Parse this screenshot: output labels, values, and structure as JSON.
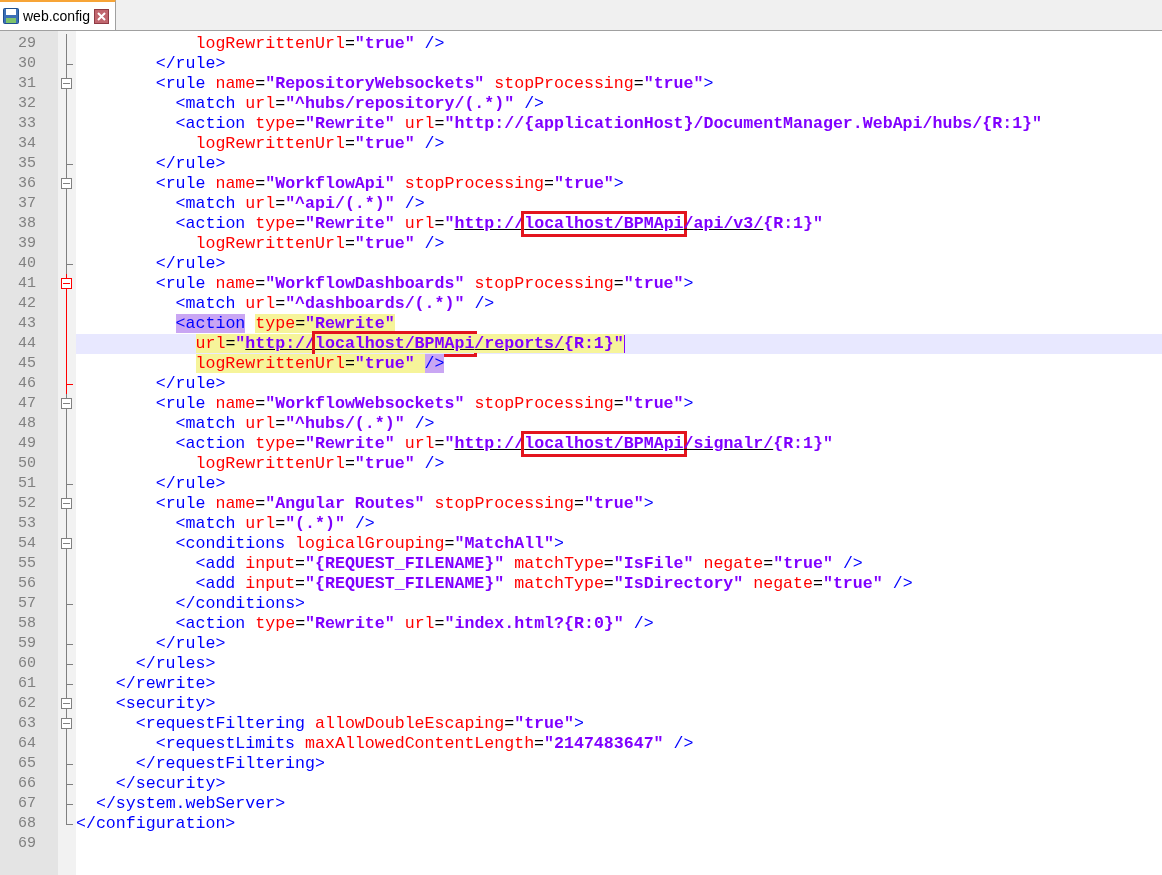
{
  "tabs": [
    {
      "label": "web.config",
      "selected": true
    }
  ],
  "lines": [
    {
      "number": "29",
      "kind": "line",
      "active": false,
      "tokens": [
        {
          "kind": "attr",
          "text": "            logRewrittenUrl"
        },
        {
          "kind": "punct",
          "text": "="
        },
        {
          "kind": "value",
          "text": "\"true\""
        },
        {
          "kind": "tag",
          "text": " />"
        }
      ]
    },
    {
      "number": "30",
      "kind": "tick",
      "active": false,
      "tokens": [
        {
          "kind": "tag",
          "text": "        </rule>"
        }
      ]
    },
    {
      "number": "31",
      "kind": "open",
      "active": false,
      "tokens": [
        {
          "kind": "tag",
          "text": "        <rule"
        },
        {
          "kind": "attr",
          "text": " name"
        },
        {
          "kind": "punct",
          "text": "="
        },
        {
          "kind": "value",
          "text": "\"RepositoryWebsockets\""
        },
        {
          "kind": "attr",
          "text": " stopProcessing"
        },
        {
          "kind": "punct",
          "text": "="
        },
        {
          "kind": "value",
          "text": "\"true\""
        },
        {
          "kind": "tag",
          "text": ">"
        }
      ]
    },
    {
      "number": "32",
      "kind": "line",
      "active": false,
      "tokens": [
        {
          "kind": "tag",
          "text": "          <match"
        },
        {
          "kind": "attr",
          "text": " url"
        },
        {
          "kind": "punct",
          "text": "="
        },
        {
          "kind": "value",
          "text": "\"^hubs/repository/(.*)\""
        },
        {
          "kind": "tag",
          "text": " />"
        }
      ]
    },
    {
      "number": "33",
      "kind": "line",
      "active": false,
      "tokens": [
        {
          "kind": "tag",
          "text": "          <action"
        },
        {
          "kind": "attr",
          "text": " type"
        },
        {
          "kind": "punct",
          "text": "="
        },
        {
          "kind": "value",
          "text": "\"Rewrite\""
        },
        {
          "kind": "attr",
          "text": " url"
        },
        {
          "kind": "punct",
          "text": "="
        },
        {
          "kind": "value",
          "text": "\"http://{applicationHost}/DocumentManager.WebApi/hubs/{R:1}\""
        }
      ]
    },
    {
      "number": "34",
      "kind": "line",
      "active": false,
      "tokens": [
        {
          "kind": "attr",
          "text": "            logRewrittenUrl"
        },
        {
          "kind": "punct",
          "text": "="
        },
        {
          "kind": "value",
          "text": "\"true\""
        },
        {
          "kind": "tag",
          "text": " />"
        }
      ]
    },
    {
      "number": "35",
      "kind": "tick",
      "active": false,
      "tokens": [
        {
          "kind": "tag",
          "text": "        </rule>"
        }
      ]
    },
    {
      "number": "36",
      "kind": "open",
      "active": false,
      "tokens": [
        {
          "kind": "tag",
          "text": "        <rule"
        },
        {
          "kind": "attr",
          "text": " name"
        },
        {
          "kind": "punct",
          "text": "="
        },
        {
          "kind": "value",
          "text": "\"WorkflowApi\""
        },
        {
          "kind": "attr",
          "text": " stopProcessing"
        },
        {
          "kind": "punct",
          "text": "="
        },
        {
          "kind": "value",
          "text": "\"true\""
        },
        {
          "kind": "tag",
          "text": ">"
        }
      ]
    },
    {
      "number": "37",
      "kind": "line",
      "active": false,
      "tokens": [
        {
          "kind": "tag",
          "text": "          <match"
        },
        {
          "kind": "attr",
          "text": " url"
        },
        {
          "kind": "punct",
          "text": "="
        },
        {
          "kind": "value",
          "text": "\"^api/(.*)\""
        },
        {
          "kind": "tag",
          "text": " />"
        }
      ]
    },
    {
      "number": "38",
      "kind": "line",
      "active": false,
      "tokens": [
        {
          "kind": "tag",
          "text": "          <action"
        },
        {
          "kind": "attr",
          "text": " type"
        },
        {
          "kind": "punct",
          "text": "="
        },
        {
          "kind": "value",
          "text": "\"Rewrite\""
        },
        {
          "kind": "attr",
          "text": " url"
        },
        {
          "kind": "punct",
          "text": "="
        },
        {
          "kind": "value",
          "text": "\""
        },
        {
          "kind": "link",
          "text": "http://"
        },
        {
          "kind": "link",
          "text": "localhost/BPMApi",
          "boxed": true
        },
        {
          "kind": "link",
          "text": "/api/v3/"
        },
        {
          "kind": "value",
          "text": "{R:1}\""
        }
      ]
    },
    {
      "number": "39",
      "kind": "line",
      "active": false,
      "tokens": [
        {
          "kind": "attr",
          "text": "            logRewrittenUrl"
        },
        {
          "kind": "punct",
          "text": "="
        },
        {
          "kind": "value",
          "text": "\"true\""
        },
        {
          "kind": "tag",
          "text": " />"
        }
      ]
    },
    {
      "number": "40",
      "kind": "tick",
      "active": false,
      "tokens": [
        {
          "kind": "tag",
          "text": "        </rule>"
        }
      ]
    },
    {
      "number": "41",
      "kind": "open",
      "active": true,
      "tokens": [
        {
          "kind": "tag",
          "text": "        <rule"
        },
        {
          "kind": "attr",
          "text": " name"
        },
        {
          "kind": "punct",
          "text": "="
        },
        {
          "kind": "value",
          "text": "\"WorkflowDashboards\""
        },
        {
          "kind": "attr",
          "text": " stopProcessing"
        },
        {
          "kind": "punct",
          "text": "="
        },
        {
          "kind": "value",
          "text": "\"true\""
        },
        {
          "kind": "tag",
          "text": ">"
        }
      ]
    },
    {
      "number": "42",
      "kind": "line",
      "active": true,
      "tokens": [
        {
          "kind": "tag",
          "text": "          <match"
        },
        {
          "kind": "attr",
          "text": " url"
        },
        {
          "kind": "punct",
          "text": "="
        },
        {
          "kind": "value",
          "text": "\"^dashboards/(.*)\""
        },
        {
          "kind": "tag",
          "text": " />"
        }
      ]
    },
    {
      "number": "43",
      "kind": "line",
      "active": true,
      "tokens": [
        {
          "kind": "tag",
          "text": "          <action",
          "matched": true
        },
        {
          "kind": "attr",
          "text": " type",
          "marked": true
        },
        {
          "kind": "punct",
          "text": "=",
          "marked": true
        },
        {
          "kind": "value",
          "text": "\"Rewrite\"",
          "marked": true
        }
      ]
    },
    {
      "number": "44",
      "kind": "line",
      "active": true,
      "current": true,
      "caret": true,
      "tokens": [
        {
          "kind": "attr",
          "text": "            url",
          "marked": true
        },
        {
          "kind": "punct",
          "text": "=",
          "marked": true
        },
        {
          "kind": "value",
          "text": "\"",
          "marked": true
        },
        {
          "kind": "link",
          "text": "http://",
          "marked": true
        },
        {
          "kind": "link",
          "text": "localhost/BPMApi",
          "marked": true,
          "boxed": true
        },
        {
          "kind": "link",
          "text": "/reports/",
          "marked": true
        },
        {
          "kind": "value",
          "text": "{R:1}\"",
          "marked": true
        }
      ]
    },
    {
      "number": "45",
      "kind": "line",
      "active": true,
      "tokens": [
        {
          "kind": "attr",
          "text": "            logRewrittenUrl",
          "marked": true
        },
        {
          "kind": "punct",
          "text": "=",
          "marked": true
        },
        {
          "kind": "value",
          "text": "\"true\" ",
          "marked": true
        },
        {
          "kind": "tag",
          "text": "/>",
          "matched": true
        }
      ]
    },
    {
      "number": "46",
      "kind": "tick",
      "active": true,
      "tokens": [
        {
          "kind": "tag",
          "text": "        </rule>"
        }
      ]
    },
    {
      "number": "47",
      "kind": "open",
      "active": false,
      "tokens": [
        {
          "kind": "tag",
          "text": "        <rule"
        },
        {
          "kind": "attr",
          "text": " name"
        },
        {
          "kind": "punct",
          "text": "="
        },
        {
          "kind": "value",
          "text": "\"WorkflowWebsockets\""
        },
        {
          "kind": "attr",
          "text": " stopProcessing"
        },
        {
          "kind": "punct",
          "text": "="
        },
        {
          "kind": "value",
          "text": "\"true\""
        },
        {
          "kind": "tag",
          "text": ">"
        }
      ]
    },
    {
      "number": "48",
      "kind": "line",
      "active": false,
      "tokens": [
        {
          "kind": "tag",
          "text": "          <match"
        },
        {
          "kind": "attr",
          "text": " url"
        },
        {
          "kind": "punct",
          "text": "="
        },
        {
          "kind": "value",
          "text": "\"^hubs/(.*)\""
        },
        {
          "kind": "tag",
          "text": " />"
        }
      ]
    },
    {
      "number": "49",
      "kind": "line",
      "active": false,
      "tokens": [
        {
          "kind": "tag",
          "text": "          <action"
        },
        {
          "kind": "attr",
          "text": " type"
        },
        {
          "kind": "punct",
          "text": "="
        },
        {
          "kind": "value",
          "text": "\"Rewrite\""
        },
        {
          "kind": "attr",
          "text": " url"
        },
        {
          "kind": "punct",
          "text": "="
        },
        {
          "kind": "value",
          "text": "\""
        },
        {
          "kind": "link",
          "text": "http://"
        },
        {
          "kind": "link",
          "text": "localhost/BPMApi",
          "boxed": true
        },
        {
          "kind": "link",
          "text": "/signalr/"
        },
        {
          "kind": "value",
          "text": "{R:1}\""
        }
      ]
    },
    {
      "number": "50",
      "kind": "line",
      "active": false,
      "tokens": [
        {
          "kind": "attr",
          "text": "            logRewrittenUrl"
        },
        {
          "kind": "punct",
          "text": "="
        },
        {
          "kind": "value",
          "text": "\"true\""
        },
        {
          "kind": "tag",
          "text": " />"
        }
      ]
    },
    {
      "number": "51",
      "kind": "tick",
      "active": false,
      "tokens": [
        {
          "kind": "tag",
          "text": "        </rule>"
        }
      ]
    },
    {
      "number": "52",
      "kind": "open",
      "active": false,
      "tokens": [
        {
          "kind": "tag",
          "text": "        <rule"
        },
        {
          "kind": "attr",
          "text": " name"
        },
        {
          "kind": "punct",
          "text": "="
        },
        {
          "kind": "value",
          "text": "\"Angular Routes\""
        },
        {
          "kind": "attr",
          "text": " stopProcessing"
        },
        {
          "kind": "punct",
          "text": "="
        },
        {
          "kind": "value",
          "text": "\"true\""
        },
        {
          "kind": "tag",
          "text": ">"
        }
      ]
    },
    {
      "number": "53",
      "kind": "line",
      "active": false,
      "tokens": [
        {
          "kind": "tag",
          "text": "          <match"
        },
        {
          "kind": "attr",
          "text": " url"
        },
        {
          "kind": "punct",
          "text": "="
        },
        {
          "kind": "value",
          "text": "\"(.*)\""
        },
        {
          "kind": "tag",
          "text": " />"
        }
      ]
    },
    {
      "number": "54",
      "kind": "open",
      "active": false,
      "tokens": [
        {
          "kind": "tag",
          "text": "          <conditions"
        },
        {
          "kind": "attr",
          "text": " logicalGrouping"
        },
        {
          "kind": "punct",
          "text": "="
        },
        {
          "kind": "value",
          "text": "\"MatchAll\""
        },
        {
          "kind": "tag",
          "text": ">"
        }
      ]
    },
    {
      "number": "55",
      "kind": "line",
      "active": false,
      "tokens": [
        {
          "kind": "tag",
          "text": "            <add"
        },
        {
          "kind": "attr",
          "text": " input"
        },
        {
          "kind": "punct",
          "text": "="
        },
        {
          "kind": "value",
          "text": "\"{REQUEST_FILENAME}\""
        },
        {
          "kind": "attr",
          "text": " matchType"
        },
        {
          "kind": "punct",
          "text": "="
        },
        {
          "kind": "value",
          "text": "\"IsFile\""
        },
        {
          "kind": "attr",
          "text": " negate"
        },
        {
          "kind": "punct",
          "text": "="
        },
        {
          "kind": "value",
          "text": "\"true\""
        },
        {
          "kind": "tag",
          "text": " />"
        }
      ]
    },
    {
      "number": "56",
      "kind": "line",
      "active": false,
      "tokens": [
        {
          "kind": "tag",
          "text": "            <add"
        },
        {
          "kind": "attr",
          "text": " input"
        },
        {
          "kind": "punct",
          "text": "="
        },
        {
          "kind": "value",
          "text": "\"{REQUEST_FILENAME}\""
        },
        {
          "kind": "attr",
          "text": " matchType"
        },
        {
          "kind": "punct",
          "text": "="
        },
        {
          "kind": "value",
          "text": "\"IsDirectory\""
        },
        {
          "kind": "attr",
          "text": " negate"
        },
        {
          "kind": "punct",
          "text": "="
        },
        {
          "kind": "value",
          "text": "\"true\""
        },
        {
          "kind": "tag",
          "text": " />"
        }
      ]
    },
    {
      "number": "57",
      "kind": "tick",
      "active": false,
      "tokens": [
        {
          "kind": "tag",
          "text": "          </conditions>"
        }
      ]
    },
    {
      "number": "58",
      "kind": "line",
      "active": false,
      "tokens": [
        {
          "kind": "tag",
          "text": "          <action"
        },
        {
          "kind": "attr",
          "text": " type"
        },
        {
          "kind": "punct",
          "text": "="
        },
        {
          "kind": "value",
          "text": "\"Rewrite\""
        },
        {
          "kind": "attr",
          "text": " url"
        },
        {
          "kind": "punct",
          "text": "="
        },
        {
          "kind": "value",
          "text": "\"index.html?{R:0}\""
        },
        {
          "kind": "tag",
          "text": " />"
        }
      ]
    },
    {
      "number": "59",
      "kind": "tick",
      "active": false,
      "tokens": [
        {
          "kind": "tag",
          "text": "        </rule>"
        }
      ]
    },
    {
      "number": "60",
      "kind": "tick",
      "active": false,
      "tokens": [
        {
          "kind": "tag",
          "text": "      </rules>"
        }
      ]
    },
    {
      "number": "61",
      "kind": "tick",
      "active": false,
      "tokens": [
        {
          "kind": "tag",
          "text": "    </rewrite>"
        }
      ]
    },
    {
      "number": "62",
      "kind": "open",
      "active": false,
      "tokens": [
        {
          "kind": "tag",
          "text": "    <security>"
        }
      ]
    },
    {
      "number": "63",
      "kind": "open",
      "active": false,
      "tokens": [
        {
          "kind": "tag",
          "text": "      <requestFiltering"
        },
        {
          "kind": "attr",
          "text": " allowDoubleEscaping"
        },
        {
          "kind": "punct",
          "text": "="
        },
        {
          "kind": "value",
          "text": "\"true\""
        },
        {
          "kind": "tag",
          "text": ">"
        }
      ]
    },
    {
      "number": "64",
      "kind": "line",
      "active": false,
      "tokens": [
        {
          "kind": "tag",
          "text": "        <requestLimits"
        },
        {
          "kind": "attr",
          "text": " maxAllowedContentLength"
        },
        {
          "kind": "punct",
          "text": "="
        },
        {
          "kind": "value",
          "text": "\"2147483647\""
        },
        {
          "kind": "tag",
          "text": " />"
        }
      ]
    },
    {
      "number": "65",
      "kind": "tick",
      "active": false,
      "tokens": [
        {
          "kind": "tag",
          "text": "      </requestFiltering>"
        }
      ]
    },
    {
      "number": "66",
      "kind": "tick",
      "active": false,
      "tokens": [
        {
          "kind": "tag",
          "text": "    </security>"
        }
      ]
    },
    {
      "number": "67",
      "kind": "tick",
      "active": false,
      "tokens": [
        {
          "kind": "tag",
          "text": "  </system.webServer>"
        }
      ]
    },
    {
      "number": "68",
      "kind": "end",
      "active": false,
      "tokens": [
        {
          "kind": "tag",
          "text": "</configuration>"
        }
      ]
    },
    {
      "number": "69",
      "kind": "none"
    }
  ]
}
